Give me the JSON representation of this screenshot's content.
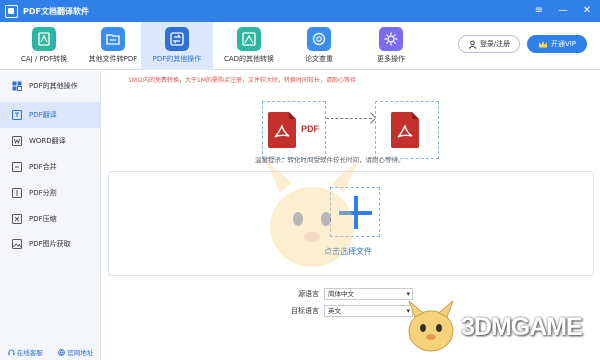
{
  "app": {
    "title": "PDF文档翻译软件"
  },
  "window_controls": {
    "menu": "≡",
    "minimize": "—",
    "close": "✕"
  },
  "toolbar": {
    "tools": [
      {
        "label": "CAJ / PDF转换",
        "icon": "caj-pdf-icon",
        "color": "#2fb6a3"
      },
      {
        "label": "其他文件转PDF",
        "icon": "file-to-pdf-icon",
        "color": "#3b8df0"
      },
      {
        "label": "PDF的其他操作",
        "icon": "pdf-ops-icon",
        "color": "#2f6fd6",
        "active": true
      },
      {
        "label": "CAD的其他转换",
        "icon": "cad-icon",
        "color": "#2fb6a3"
      },
      {
        "label": "论文查重",
        "icon": "paper-check-icon",
        "color": "#3b8df0"
      },
      {
        "label": "更多操作",
        "icon": "more-ops-icon",
        "color": "#7b6cf0"
      }
    ],
    "login_label": "登录/注册",
    "vip_label": "开通VIP"
  },
  "sidebar": {
    "items": [
      {
        "label": "PDF的其他操作",
        "icon": "grid-icon"
      },
      {
        "label": "PDF翻译",
        "icon": "translate-icon",
        "active": true
      },
      {
        "label": "WORD翻译",
        "icon": "word-icon"
      },
      {
        "label": "PDF合并",
        "icon": "merge-icon"
      },
      {
        "label": "PDF分割",
        "icon": "split-icon"
      },
      {
        "label": "PDF压缩",
        "icon": "compress-icon"
      },
      {
        "label": "PDF图片获取",
        "icon": "image-icon"
      }
    ],
    "footer": {
      "service": "在线客服",
      "website": "官网地址"
    }
  },
  "main": {
    "notice": "1M以内的免费转换，大于1M的需购买注册，文件较大时，转换时间较长，请耐心等待",
    "pdf_label": "PDF",
    "hint": "温馨提示：转化时间受软件较长时间，请耐心等待。",
    "drop_label": "点击选择文件",
    "source_lang_label": "源语言",
    "source_lang_value": "简体中文",
    "target_lang_label": "目标语言",
    "target_lang_value": "英文"
  },
  "watermark": {
    "text": "3DMGAME"
  }
}
